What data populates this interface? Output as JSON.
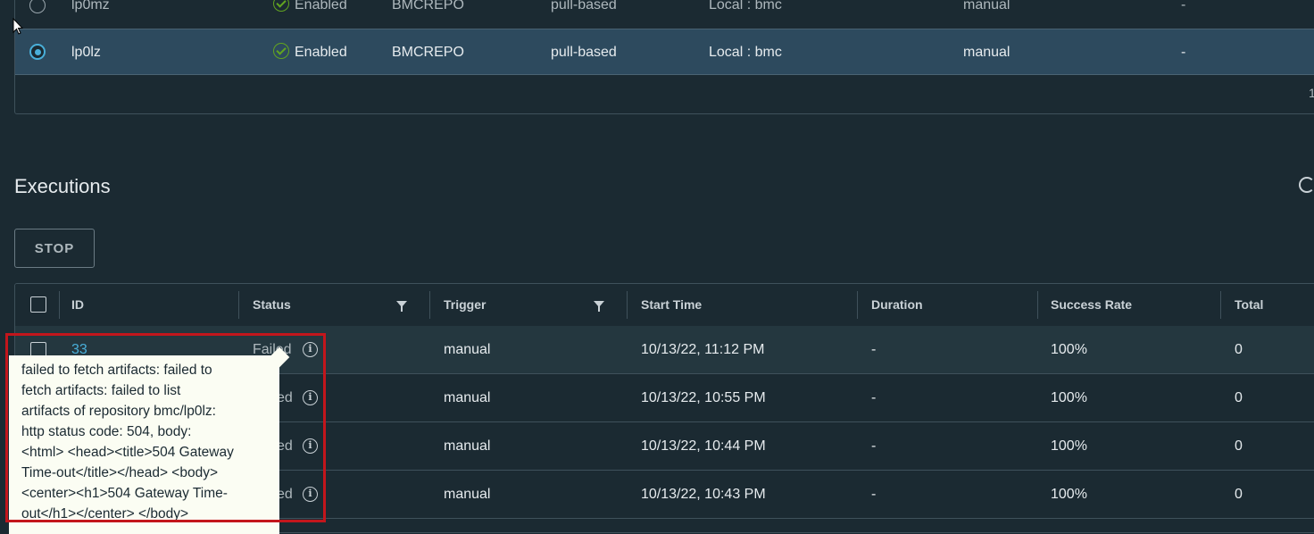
{
  "replications": {
    "rows": [
      {
        "name": "lp0mz",
        "status": "Enabled",
        "registry": "BMCREPO",
        "mode": "pull-based",
        "destination": "Local : bmc",
        "trigger": "manual",
        "extra": "-",
        "selected": false
      },
      {
        "name": "lp0lz",
        "status": "Enabled",
        "registry": "BMCREPO",
        "mode": "pull-based",
        "destination": "Local : bmc",
        "trigger": "manual",
        "extra": "-",
        "selected": true
      }
    ],
    "page_indicator": "1"
  },
  "executions": {
    "title": "Executions",
    "stop_label": "STOP",
    "columns": [
      "ID",
      "Status",
      "Trigger",
      "Start Time",
      "Duration",
      "Success Rate",
      "Total"
    ],
    "rows": [
      {
        "id": "33",
        "status": "Failed",
        "trigger": "manual",
        "start": "10/13/22, 11:12 PM",
        "duration": "-",
        "rate": "100%",
        "total": "0"
      },
      {
        "id": "",
        "status": "ed",
        "trigger": "manual",
        "start": "10/13/22, 10:55 PM",
        "duration": "-",
        "rate": "100%",
        "total": "0"
      },
      {
        "id": "",
        "status": "ed",
        "trigger": "manual",
        "start": "10/13/22, 10:44 PM",
        "duration": "-",
        "rate": "100%",
        "total": "0"
      },
      {
        "id": "",
        "status": "ed",
        "trigger": "manual",
        "start": "10/13/22, 10:43 PM",
        "duration": "-",
        "rate": "100%",
        "total": "0"
      }
    ]
  },
  "tooltip": {
    "text": "failed to fetch artifacts: failed to\nfetch artifacts: failed to list\nartifacts of repository bmc/lp0lz:\nhttp status code: 504, body:\n<html> <head><title>504 Gateway\nTime-out</title></head> <body>\n<center><h1>504 Gateway Time-\nout</h1></center> </body>"
  },
  "icons": {
    "status_enabled": "check-circle-icon",
    "filter": "filter-icon",
    "info": "info-circle-icon",
    "refresh": "refresh-icon"
  },
  "colors": {
    "background": "#1b2a32",
    "selected_row": "#2d4a5e",
    "link": "#49afd9",
    "success": "#62a420",
    "highlight": "#c3161c",
    "tooltip_bg": "#fbfdf3"
  }
}
